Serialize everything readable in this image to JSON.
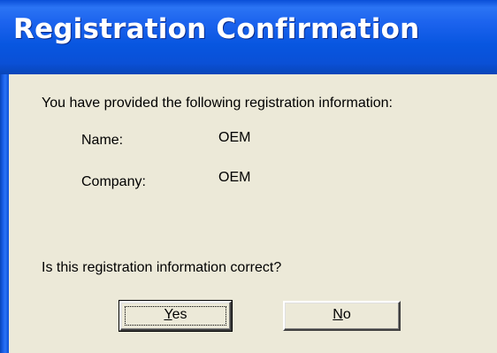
{
  "window": {
    "title": "Registration Confirmation"
  },
  "message": {
    "intro": "You have provided the following registration information:",
    "question": "Is this registration information correct?"
  },
  "fields": [
    {
      "label": "Name:",
      "value": "OEM"
    },
    {
      "label": "Company:",
      "value": "OEM"
    }
  ],
  "buttons": {
    "yes": {
      "mnemonic": "Y",
      "rest": "es"
    },
    "no": {
      "mnemonic": "N",
      "rest": "o"
    }
  },
  "colors": {
    "titlebar": "#0a4fd8",
    "dialog_background": "#ece9d8",
    "title_text": "#ffffff"
  }
}
